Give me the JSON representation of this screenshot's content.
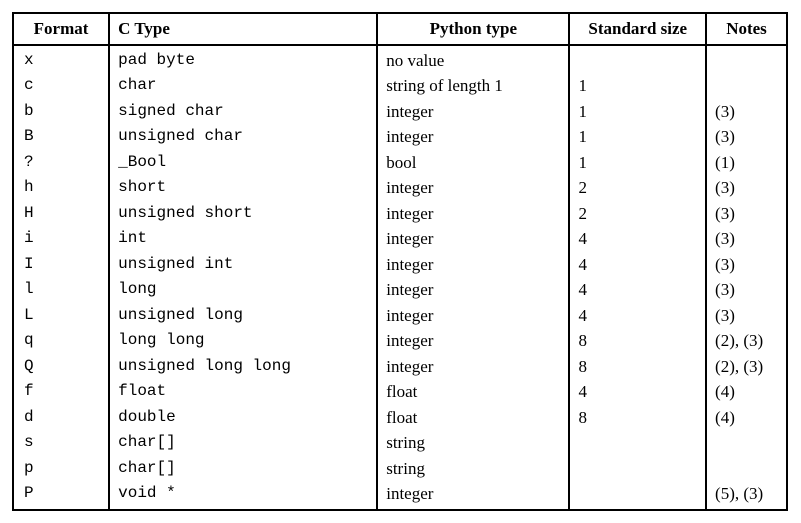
{
  "table": {
    "headers": {
      "format": "Format",
      "ctype": "C Type",
      "ptype": "Python type",
      "size": "Standard size",
      "notes": "Notes"
    },
    "rows": [
      {
        "format": "x",
        "ctype": "pad byte",
        "ptype": "no value",
        "size": "",
        "notes": ""
      },
      {
        "format": "c",
        "ctype": "char",
        "ptype": "string of length 1",
        "size": "1",
        "notes": ""
      },
      {
        "format": "b",
        "ctype": "signed char",
        "ptype": "integer",
        "size": "1",
        "notes": "(3)"
      },
      {
        "format": "B",
        "ctype": "unsigned char",
        "ptype": "integer",
        "size": "1",
        "notes": "(3)"
      },
      {
        "format": "?",
        "ctype": "_Bool",
        "ptype": "bool",
        "size": "1",
        "notes": "(1)"
      },
      {
        "format": "h",
        "ctype": "short",
        "ptype": "integer",
        "size": "2",
        "notes": "(3)"
      },
      {
        "format": "H",
        "ctype": "unsigned short",
        "ptype": "integer",
        "size": "2",
        "notes": "(3)"
      },
      {
        "format": "i",
        "ctype": "int",
        "ptype": "integer",
        "size": "4",
        "notes": "(3)"
      },
      {
        "format": "I",
        "ctype": "unsigned int",
        "ptype": "integer",
        "size": "4",
        "notes": "(3)"
      },
      {
        "format": "l",
        "ctype": "long",
        "ptype": "integer",
        "size": "4",
        "notes": "(3)"
      },
      {
        "format": "L",
        "ctype": "unsigned long",
        "ptype": "integer",
        "size": "4",
        "notes": "(3)"
      },
      {
        "format": "q",
        "ctype": "long long",
        "ptype": "integer",
        "size": "8",
        "notes": "(2), (3)"
      },
      {
        "format": "Q",
        "ctype": "unsigned long long",
        "ptype": "integer",
        "size": "8",
        "notes": "(2), (3)"
      },
      {
        "format": "f",
        "ctype": "float",
        "ptype": "float",
        "size": "4",
        "notes": "(4)"
      },
      {
        "format": "d",
        "ctype": "double",
        "ptype": "float",
        "size": "8",
        "notes": "(4)"
      },
      {
        "format": "s",
        "ctype": "char[]",
        "ptype": "string",
        "size": "",
        "notes": ""
      },
      {
        "format": "p",
        "ctype": "char[]",
        "ptype": "string",
        "size": "",
        "notes": ""
      },
      {
        "format": "P",
        "ctype": "void *",
        "ptype": "integer",
        "size": "",
        "notes": "(5), (3)"
      }
    ]
  }
}
